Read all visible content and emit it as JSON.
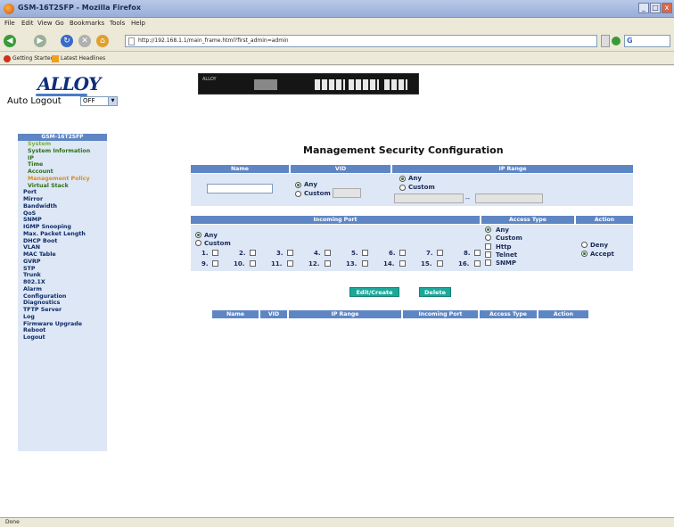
{
  "window": {
    "title": "GSM-16T2SFP - Mozilla Firefox",
    "minimize": "_",
    "maximize": "□",
    "close": "x"
  },
  "menu": [
    "File",
    "Edit",
    "View",
    "Go",
    "Bookmarks",
    "Tools",
    "Help"
  ],
  "url": "http://192.168.1.1/main_frame.html?first_admin=admin",
  "bookmarks": [
    "Getting Started",
    "Latest Headlines"
  ],
  "status": "Done",
  "logo": "ALLOY",
  "auto_logout": {
    "label": "Auto Logout",
    "value": "OFF"
  },
  "sidebar": {
    "header": "GSM-16T2SFP",
    "items": [
      "System",
      "System Information",
      "IP",
      "Time",
      "Account",
      "Management Policy",
      "Virtual Stack",
      "Port",
      "Mirror",
      "Bandwidth",
      "QoS",
      "SNMP",
      "IGMP Snooping",
      "Max. Packet Length",
      "DHCP Boot",
      "VLAN",
      "MAC Table",
      "GVRP",
      "STP",
      "Trunk",
      "802.1X",
      "Alarm",
      "Configuration",
      "Diagnostics",
      "TFTP Server",
      "Log",
      "Firmware Upgrade",
      "Reboot",
      "Logout"
    ]
  },
  "banner_logo": "ALLOY",
  "page_title": "Management Security Configuration",
  "top_table": {
    "headers": [
      "Name",
      "VID",
      "IP Range"
    ],
    "vid_options": [
      "Any",
      "Custom"
    ],
    "ip_options": [
      "Any",
      "Custom"
    ],
    "ip_separator": "--"
  },
  "mid_table": {
    "headers": [
      "Incoming Port",
      "Access Type",
      "Action"
    ],
    "port_options": [
      "Any",
      "Custom"
    ],
    "ports": [
      "1.",
      "2.",
      "3.",
      "4.",
      "5.",
      "6.",
      "7.",
      "8.",
      "9.",
      "10.",
      "11.",
      "12.",
      "13.",
      "14.",
      "15.",
      "16."
    ],
    "access_options": [
      "Any",
      "Custom"
    ],
    "access_types": [
      "Http",
      "Telnet",
      "SNMP"
    ],
    "actions": [
      "Deny",
      "Accept"
    ]
  },
  "buttons": {
    "edit_create": "Edit/Create",
    "delete": "Delete"
  },
  "result_headers": [
    "Name",
    "VID",
    "IP Range",
    "Incoming Port",
    "Access Type",
    "Action"
  ]
}
